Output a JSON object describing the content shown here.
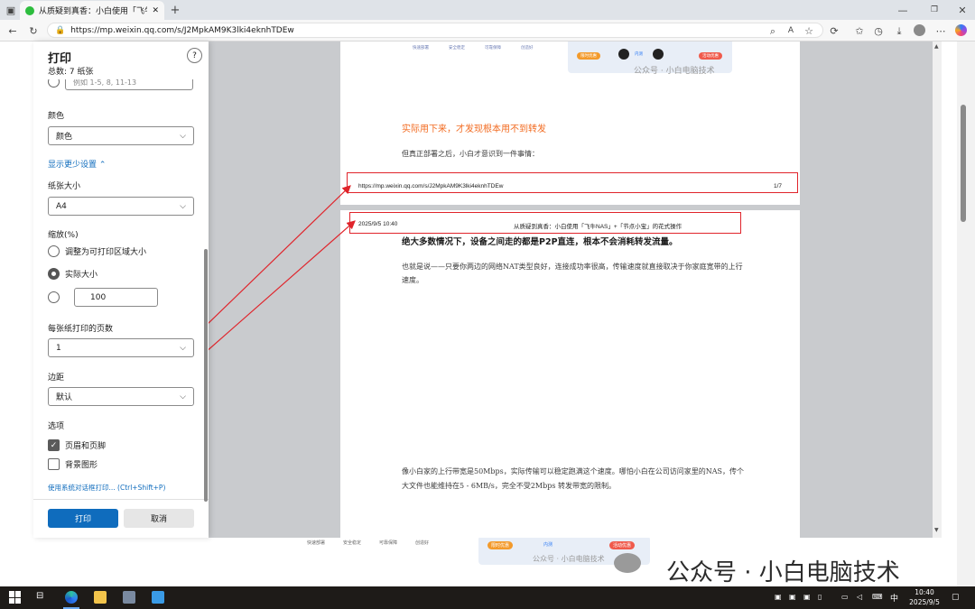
{
  "browser": {
    "tab_title": "从质疑到真香：小白使用「飞牛N",
    "url": "https://mp.weixin.qq.com/s/J2MpkAM9K3lki4eknhTDEw"
  },
  "print_panel": {
    "title": "打印",
    "total": "总数: 7 纸张",
    "help": "?",
    "pages_custom_placeholder": "例如 1-5, 8, 11-13",
    "color_label": "颜色",
    "color_value": "颜色",
    "fewer_settings": "显示更少设置",
    "paper_size_label": "纸张大小",
    "paper_size_value": "A4",
    "scale_label": "缩放(%)",
    "scale_fit": "调整为可打印区域大小",
    "scale_actual": "实际大小",
    "scale_custom": "100",
    "pages_per_sheet_label": "每张纸打印的页数",
    "pages_per_sheet_value": "1",
    "margins_label": "边距",
    "margins_value": "默认",
    "options_label": "选项",
    "header_footer": "页眉和页脚",
    "background_graphics": "背景图形",
    "system_dialog": "使用系统对话框打印... (Ctrl+Shift+P)",
    "print_button": "打印",
    "cancel_button": "取消"
  },
  "preview": {
    "top_icons": [
      "快速部署",
      "安全稳定",
      "可靠保障",
      "创造好"
    ],
    "badge_left": "限时优惠",
    "badge_right": "活动优惠",
    "badge_mid": "内测",
    "watermark_small": "公众号 · 小白电脑技术",
    "orange_heading": "实际用下来，才发现根本用不到转发",
    "para1": "但真正部署之后，小白才意识到一件事情：",
    "footer_url": "https://mp.weixin.qq.com/s/J2MpkAM9K3lki4eknhTDEw",
    "footer_page": "1/7",
    "header_date": "2025/9/5 10:40",
    "header_title": "从质疑到真香：小白使用「飞牛NAS」+「节点小宝」的花式操作",
    "bold_line": "绝大多数情况下，设备之间走的都是P2P直连，根本不会消耗转发流量。",
    "para2": "也就是说——只要你两边的网络NAT类型良好，连接成功率很高，传输速度就直接取决于你家庭宽带的上行速度。",
    "para3": "像小白家的上行带宽是50Mbps，实际传输可以稳定跑满这个速度。哪怕小白在公司访问家里的NAS，传个大文件也能维持在5 - 6MB/s，完全不受2Mbps  转发带宽的限制。"
  },
  "page_behind": {
    "watermark": "公众号 · 小白电脑技术",
    "icons": [
      "快速部署",
      "安全稳定",
      "可靠保障",
      "创造好"
    ],
    "badge_left": "限时优惠",
    "badge_right": "活动优惠",
    "badge_mid": "内测",
    "watermark_small": "公众号 · 小白电脑技术"
  },
  "taskbar": {
    "time": "10:40",
    "date": "2025/9/5",
    "ime": "中"
  },
  "colors": {
    "accent": "#0f6cbd",
    "annotation_red": "#e0242b",
    "orange_heading": "#f26b21"
  }
}
